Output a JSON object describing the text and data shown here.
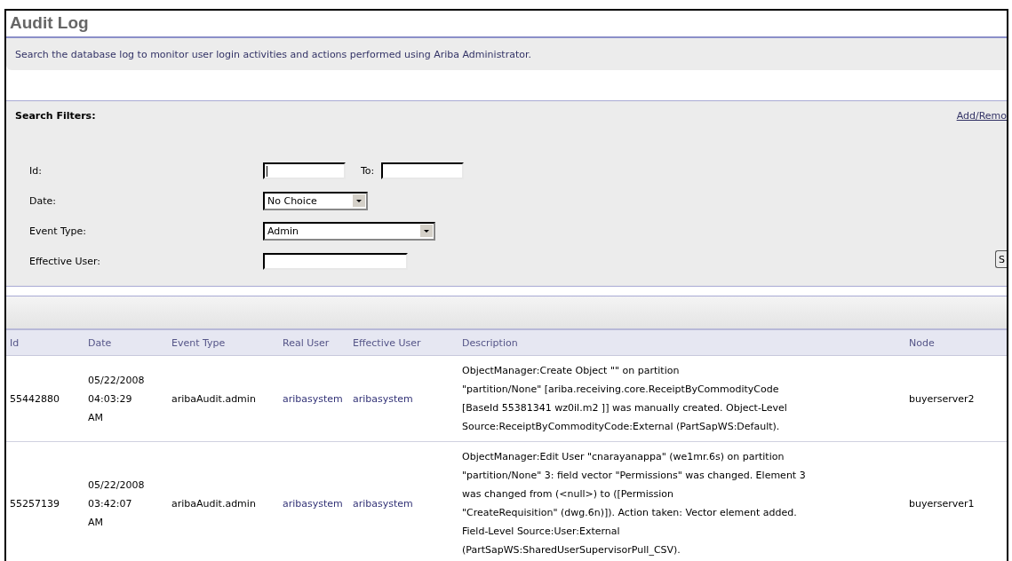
{
  "page": {
    "title": "Audit Log",
    "description": "Search the database log to monitor user login activities and actions performed using Ariba Administrator."
  },
  "filters": {
    "heading": "Search Filters:",
    "add_remove_link": "Add/Remo",
    "search_button": "S",
    "fields": [
      {
        "kind": "range",
        "label": "Id:",
        "to_label": "To:",
        "focused": true
      },
      {
        "kind": "select",
        "label": "Date:",
        "value": "No Choice"
      },
      {
        "kind": "select",
        "label": "Event Type:",
        "value": "Admin"
      },
      {
        "kind": "text",
        "label": "Effective User:"
      }
    ]
  },
  "table": {
    "columns": [
      "Id",
      "Date",
      "Event Type",
      "Real User",
      "Effective User",
      "Description",
      "Node"
    ],
    "rows": [
      {
        "id": "55442880",
        "date": [
          "05/22/2008",
          "04:03:29",
          "AM"
        ],
        "event_type": "aribaAudit.admin",
        "real_user": "aribasystem",
        "effective_user": "aribasystem",
        "description": [
          "ObjectManager:Create Object \"\" on partition",
          "\"partition/None\" [ariba.receiving.core.ReceiptByCommodityCode",
          "[BaseId 55381341 wz0il.m2 ]] was manually created. Object-Level",
          "Source:ReceiptByCommodityCode:External (PartSapWS:Default)."
        ],
        "node": "buyerserver2"
      },
      {
        "id": "55257139",
        "date": [
          "05/22/2008",
          "03:42:07",
          "AM"
        ],
        "event_type": "aribaAudit.admin",
        "real_user": "aribasystem",
        "effective_user": "aribasystem",
        "description": [
          "ObjectManager:Edit User \"cnarayanappa\" (we1mr.6s) on partition",
          "\"partition/None\" 3: field vector \"Permissions\" was changed. Element 3",
          "was changed from (<null>) to ([Permission",
          "\"CreateRequisition\" (dwg.6n)]). Action taken: Vector element added.",
          "Field-Level Source:User:External",
          "(PartSapWS:SharedUserSupervisorPull_CSV)."
        ],
        "node": "buyerserver1"
      }
    ]
  }
}
